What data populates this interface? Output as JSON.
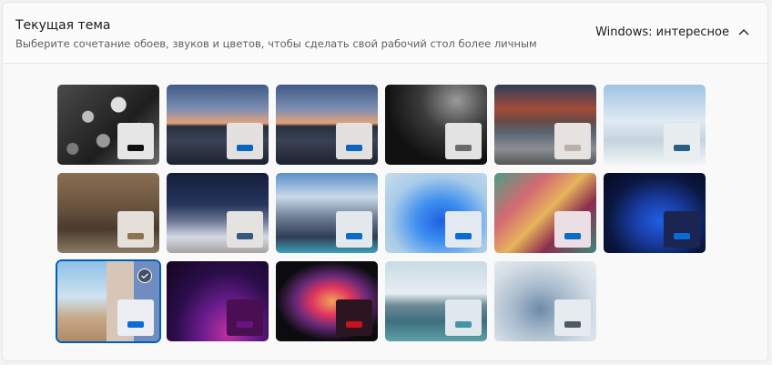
{
  "header": {
    "title": "Текущая тема",
    "subtitle": "Выберите сочетание обоев, звуков и цветов, чтобы сделать свой рабочий стол более личным",
    "current_theme": "Windows: интересное",
    "collapse_icon": "chevron-up-icon"
  },
  "themes": [
    {
      "wallpaper": "grey-cubes",
      "swatch": "#e6e6e6",
      "accent": "#111111"
    },
    {
      "wallpaper": "lofoten-sunset",
      "swatch": "#e3e1df",
      "accent": "#0a64c2"
    },
    {
      "wallpaper": "lofoten-sunset",
      "swatch": "#e3e1df",
      "accent": "#0a64c2"
    },
    {
      "wallpaper": "dark-curves",
      "swatch": "#e3e3e3",
      "accent": "#6b6b6b"
    },
    {
      "wallpaper": "mountain-road",
      "swatch": "#e5e2df",
      "accent": "#b9b1aa"
    },
    {
      "wallpaper": "snowy-trees",
      "swatch": "#e8edf0",
      "accent": "#2c5f86"
    },
    {
      "wallpaper": "sepia-tower",
      "swatch": "#e4dfd8",
      "accent": "#8b7450"
    },
    {
      "wallpaper": "night-snow",
      "swatch": "#e5e3e0",
      "accent": "#355a7c"
    },
    {
      "wallpaper": "glacier-lake",
      "swatch": "#e3e8ec",
      "accent": "#0a6cc4"
    },
    {
      "wallpaper": "bloom-light",
      "swatch": "#e3e9f1",
      "accent": "#0a6cd4"
    },
    {
      "wallpaper": "dragon-art",
      "swatch": "#ecdfe3",
      "accent": "#0a6cc4"
    },
    {
      "wallpaper": "bloom-dark",
      "swatch": "#1a2552",
      "accent": "#0a6cd4"
    },
    {
      "wallpaper": "blossom-beach",
      "swatch": "#eceef2",
      "accent": "#0a6cd4",
      "selected": true
    },
    {
      "wallpaper": "purple-glow",
      "swatch": "#4a0f52",
      "accent": "#6a1380"
    },
    {
      "wallpaper": "color-flow",
      "swatch": "#2a1520",
      "accent": "#c8101e"
    },
    {
      "wallpaper": "calm-lake",
      "swatch": "#dfe8ec",
      "accent": "#4a93a6"
    },
    {
      "wallpaper": "soft-bloom",
      "swatch": "#e6ebef",
      "accent": "#4c5a66"
    }
  ],
  "colors": {
    "selection": "#005fb8",
    "card_bg": "#fbfbfb"
  }
}
